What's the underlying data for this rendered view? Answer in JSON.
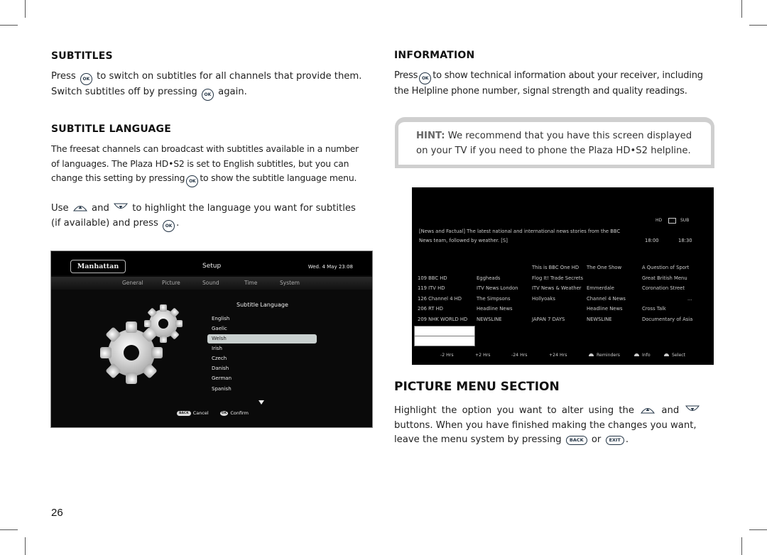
{
  "page_number": "26",
  "left_column": {
    "subtitles": {
      "heading": "SUBTITLES",
      "line1_a": "Press",
      "line1_b": "to switch on subtitles for all channels that provide them.",
      "line2_a": "Switch subtitles off by pressing",
      "line2_b": "again."
    },
    "subtitle_language": {
      "heading": "SUBTITLE LANGUAGE",
      "para1_l1": "The freesat channels can broadcast with subtitles available in a number",
      "para1_l2": "of languages. The Plaza HD•S2 is set to English subtitles, but you can",
      "para1_l3a": "change this setting by pressing",
      "para1_l3b": "to show the subtitle language menu.",
      "para2_a": "Use",
      "para2_b": "and",
      "para2_c": "to highlight the language you want for subtitles",
      "para2_d": "(if available) and press",
      "para2_e": "."
    }
  },
  "remote_buttons": {
    "ok": "OK",
    "back": "BACK",
    "exit": "EXIT"
  },
  "setup_screen": {
    "logo": "Manhattan",
    "title": "Setup",
    "datetime": "Wed. 4 May  23:08",
    "tabs": [
      "General",
      "Picture",
      "Sound",
      "Time",
      "System"
    ],
    "list_title": "Subtitle Language",
    "languages": [
      "English",
      "Gaelic",
      "Welsh",
      "Irish",
      "Czech",
      "Danish",
      "German",
      "Spanish"
    ],
    "selected_language": "Welsh",
    "cancel_key": "BACK",
    "cancel_label": "Cancel",
    "confirm_key": "OK",
    "confirm_label": "Confirm"
  },
  "right_column": {
    "information": {
      "heading": "INFORMATION",
      "line1_a": "Press",
      "line1_b": "to show technical information about your receiver, including",
      "line2": "the Helpline phone number, signal strength and quality readings."
    },
    "hint": {
      "label": "HINT:",
      "line1": "We recommend that you have this screen displayed",
      "line2": "on your TV if you need to phone the Plaza HD•S2 helpline."
    },
    "picture_menu": {
      "heading": "PICTURE MENU SECTION",
      "line1_a": "Highlight the option you want to alter using the",
      "line1_b": "and",
      "line2": "buttons. When you have finished making the changes you want,",
      "line3_a": "leave the menu system by pressing",
      "line3_b": "or",
      "line3_c": "."
    }
  },
  "guide_screen": {
    "indicators": [
      "HD",
      "SUB"
    ],
    "description_l1": "[News and Factual] The latest national and international news stories from the BBC",
    "description_l2": "News team, followed by weather. [S]",
    "start_time": "18:00",
    "end_time": "18:30",
    "rows": [
      {
        "channel": "",
        "p1": "",
        "p2": "This is BBC One HD",
        "p3": "The One Show",
        "p4": "A Question of Sport"
      },
      {
        "channel": "109 BBC HD",
        "p1": "Eggheads",
        "p2": "Flog It! Trade Secrets",
        "p3": "",
        "p4": "Great British Menu"
      },
      {
        "channel": "119 ITV HD",
        "p1": "ITV News London",
        "p2": "ITV News & Weather",
        "p3": "Emmerdale",
        "p4": "Coronation Street"
      },
      {
        "channel": "126 Channel 4 HD",
        "p1": "The Simpsons",
        "p2": "Hollyoaks",
        "p3": "Channel 4 News",
        "p4": "..."
      },
      {
        "channel": "206 RT HD",
        "p1": "Headline News",
        "p2": "",
        "p3": "Headline News",
        "p4": "Cross Talk"
      },
      {
        "channel": "209 NHK WORLD HD",
        "p1": "NEWSLINE",
        "p2": "JAPAN 7 DAYS",
        "p3": "NEWSLINE",
        "p4": "Documentary of Asia"
      }
    ],
    "footer": [
      "-2 Hrs",
      "+2 Hrs",
      "-24 Hrs",
      "+24 Hrs",
      "Reminders",
      "Info",
      "Select"
    ]
  }
}
